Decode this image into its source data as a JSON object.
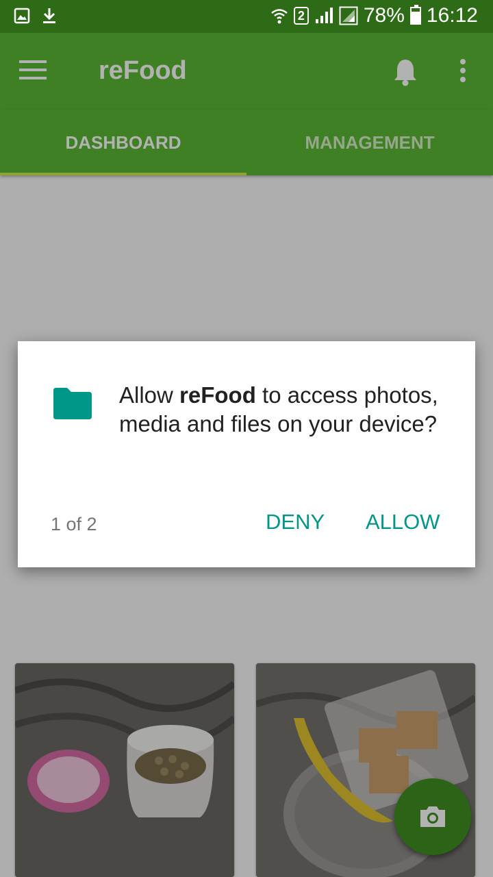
{
  "status_bar": {
    "sim_slot": "2",
    "battery": "78%",
    "time": "16:12",
    "left_icons": [
      "gallery-notification-icon",
      "download-icon"
    ],
    "right_icons": [
      "wifi-icon",
      "signal-icon",
      "signal-icon-2",
      "battery-icon"
    ]
  },
  "toolbar": {
    "title": "reFood",
    "icons": [
      "menu-icon",
      "bell-icon",
      "more-vertical-icon"
    ]
  },
  "tabs": [
    {
      "label": "DASHBOARD",
      "selected": true
    },
    {
      "label": "MANAGEMENT",
      "selected": false
    }
  ],
  "dialog": {
    "message_prefix": "Allow ",
    "app_name": "reFood",
    "message_suffix": " to access photos, media and files on your device?",
    "counter": "1 of 2",
    "deny_label": "DENY",
    "allow_label": "ALLOW",
    "icon": "folder-icon"
  },
  "fab": {
    "icon": "camera-icon"
  },
  "colors": {
    "status_bar": "#2d6b16",
    "toolbar": "#5bb834",
    "tab_indicator": "#cde84a",
    "accent": "#009688",
    "fab": "#3f8f22"
  }
}
